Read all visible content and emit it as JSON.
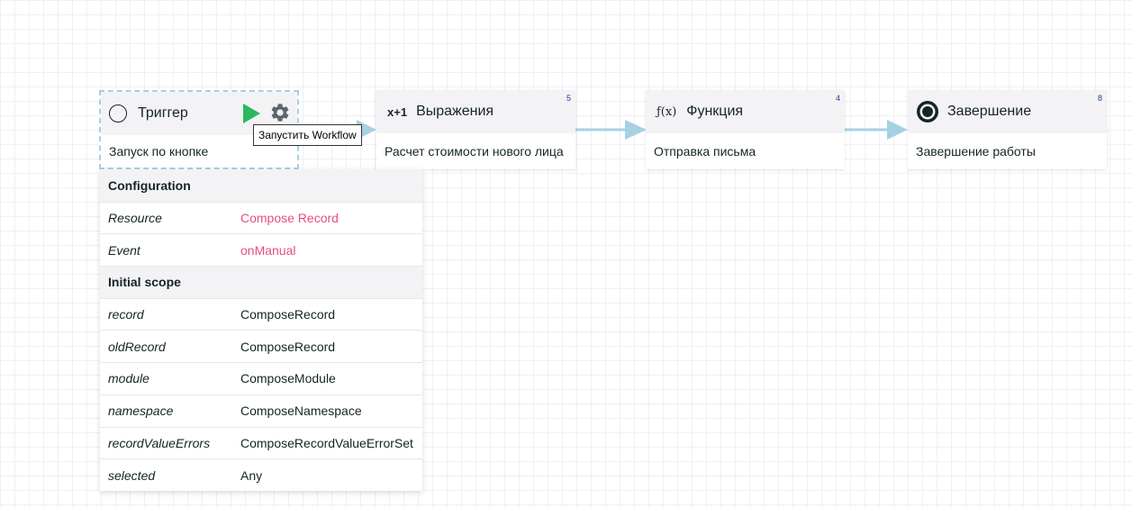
{
  "nodes": {
    "trigger": {
      "title": "Триггер",
      "description": "Запуск по кнопке",
      "run_tooltip": "Запустить Workflow"
    },
    "expression": {
      "icon_text": "x+1",
      "title": "Выражения",
      "description": "Расчет стоимости нового лица",
      "badge": "5"
    },
    "function": {
      "icon_text": "ƒ(x)",
      "title": "Функция",
      "description": "Отправка письма",
      "badge": "4"
    },
    "completion": {
      "title": "Завершение",
      "description": "Завершение работы",
      "badge": "8"
    }
  },
  "config_panel": {
    "configuration": {
      "heading": "Configuration",
      "rows": [
        {
          "key": "Resource",
          "value": "Compose Record"
        },
        {
          "key": "Event",
          "value": "onManual"
        }
      ]
    },
    "initial_scope": {
      "heading": "Initial scope",
      "rows": [
        {
          "key": "record",
          "value": "ComposeRecord"
        },
        {
          "key": "oldRecord",
          "value": "ComposeRecord"
        },
        {
          "key": "module",
          "value": "ComposeModule"
        },
        {
          "key": "namespace",
          "value": "ComposeNamespace"
        },
        {
          "key": "recordValueErrors",
          "value": "ComposeRecordValueErrorSet"
        },
        {
          "key": "selected",
          "value": "Any"
        }
      ]
    }
  },
  "colors": {
    "play": "#2db75f",
    "accent_value": "#e54d84",
    "arrow": "#a7d0e3",
    "header_bg": "#f3f3f5",
    "badge": "#1a3f8a"
  },
  "icons": {
    "trigger": "circle-outline-icon",
    "run": "play-icon",
    "settings": "gear-icon",
    "expression": "expression-icon",
    "function": "function-icon",
    "completion": "stop-circle-icon"
  }
}
